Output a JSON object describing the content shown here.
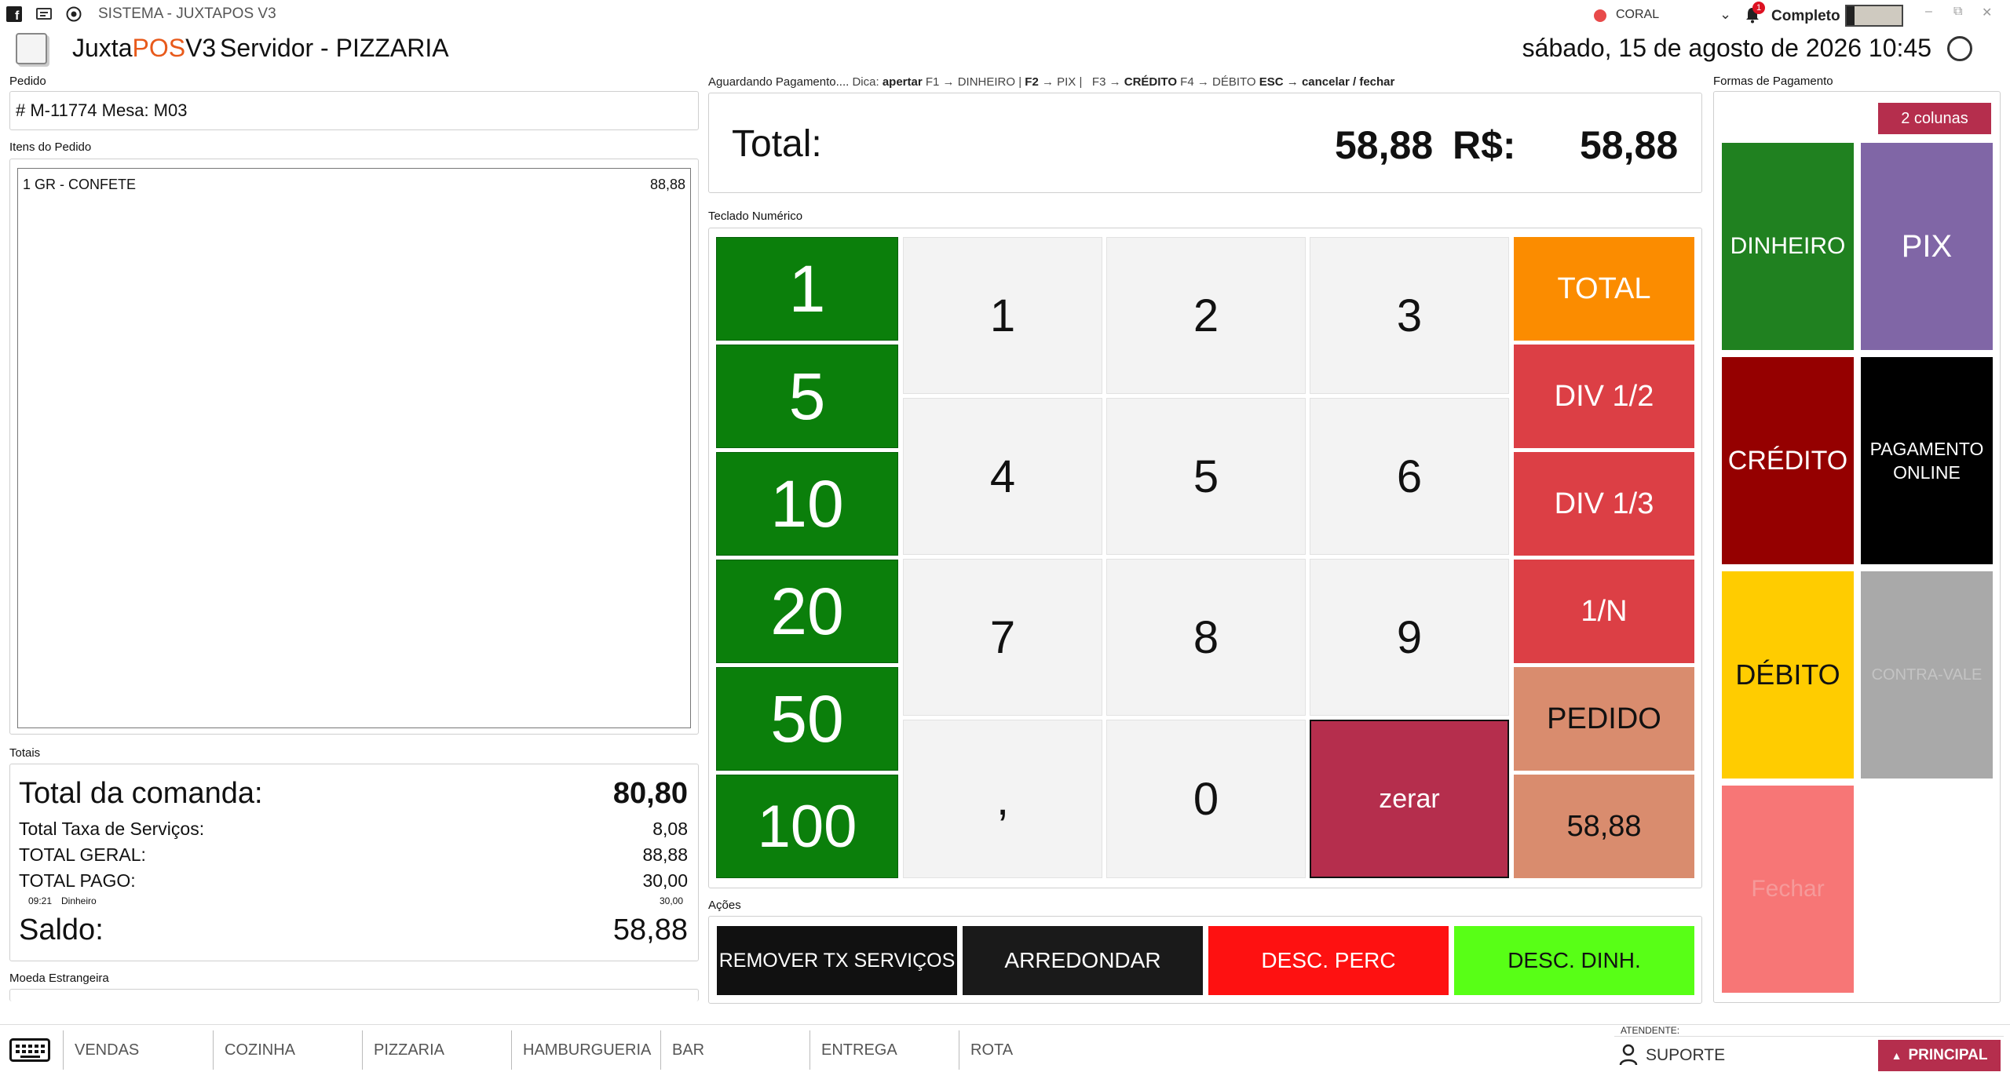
{
  "titlebar": {
    "system_title": "SISTEMA - JUXTAPOS V3",
    "status_name": "CORAL",
    "notification_count": "1",
    "mode_label": "Completo",
    "win_restore": "⧉",
    "win_minimize": "–"
  },
  "header": {
    "app_name_prefix": "Juxta",
    "app_name_pos": "POS",
    "app_name_suffix": "V3",
    "server": "Servidor - PIZZARIA",
    "datetime": "sábado, 15 de agosto de 2026 10:45"
  },
  "pedido": {
    "label": "Pedido",
    "value": "# M-11774 Mesa: M03",
    "items_label": "Itens do Pedido",
    "items": [
      {
        "desc": "1  GR -  CONFETE",
        "value": "88,88"
      }
    ]
  },
  "totais": {
    "label": "Totais",
    "comanda_label": "Total da comanda:",
    "comanda_value": "80,80",
    "taxa_label": "Total Taxa de Serviços:",
    "taxa_value": "8,08",
    "geral_label": "TOTAL GERAL:",
    "geral_value": "88,88",
    "pago_label": "TOTAL PAGO:",
    "pago_value": "30,00",
    "pay_time": "09:21",
    "pay_method": "Dinheiro",
    "pay_value": "30,00",
    "saldo_label": "Saldo:",
    "saldo_value": "58,88"
  },
  "moeda": {
    "label": "Moeda Estrangeira"
  },
  "payment": {
    "status": "Aguardando Pagamento....",
    "hint": {
      "dica": "Dica:",
      "apertar": "apertar",
      "f1": "F1 → DINHEIRO |",
      "f2": "F2",
      "f2b": "→ PIX |",
      "f3": "F3 →",
      "credito": "CRÉDITO",
      "f4": "F4 → DÉBITO",
      "esc": "ESC → cancelar / fechar"
    },
    "total_label": "Total:",
    "total_value": "58,88",
    "currency": "R$:",
    "currency_value": "58,88"
  },
  "keypad": {
    "label": "Teclado Numérico",
    "quick": [
      "1",
      "5",
      "10",
      "20",
      "50",
      "100"
    ],
    "digits": [
      "1",
      "2",
      "3",
      "4",
      "5",
      "6",
      "7",
      "8",
      "9",
      ",",
      "0"
    ],
    "zerar": "zerar",
    "right": [
      "TOTAL",
      "DIV 1/2",
      "DIV 1/3",
      "1/N",
      "PEDIDO",
      "58,88"
    ]
  },
  "formas": {
    "label": "Formas de Pagamento",
    "columns_button": "2 colunas",
    "dinheiro": "DINHEIRO",
    "pix": "PIX",
    "credito": "CRÉDITO",
    "online": "PAGAMENTO ONLINE",
    "debito": "DÉBITO",
    "contravale": "CONTRA-VALE",
    "fechar": "Fechar"
  },
  "acoes": {
    "label": "Ações",
    "remover": "REMOVER TX SERVIÇOS",
    "arredondar": "ARREDONDAR",
    "desc_perc": "DESC. PERC",
    "desc_dinh": "DESC. DINH."
  },
  "nav": {
    "items": [
      "VENDAS",
      "COZINHA",
      "PIZZARIA",
      "HAMBURGUERIA",
      "BAR",
      "ENTREGA",
      "ROTA"
    ],
    "atendente_label": "ATENDENTE:",
    "atendente": "SUPORTE",
    "principal": "PRINCIPAL"
  },
  "colors": {
    "green": "#0b7f0b",
    "orange": "#fb8c00",
    "red": "#dc3f45",
    "salmon": "#d98c6e",
    "zerar": "#b52e4d",
    "pix": "#8066a6",
    "credito": "#950000",
    "debito": "#ffcc00",
    "fechar": "#f77676"
  }
}
